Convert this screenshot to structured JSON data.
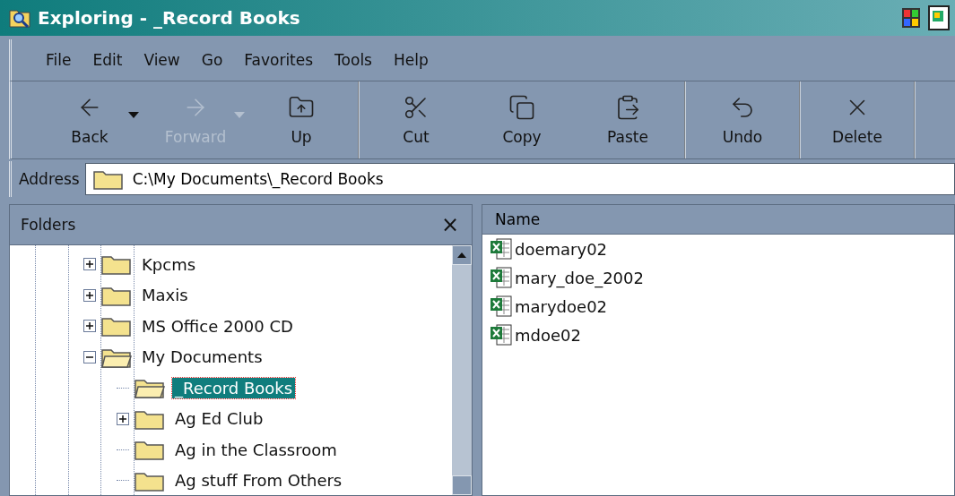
{
  "window": {
    "title": "Exploring - _Record Books"
  },
  "menu": [
    "File",
    "Edit",
    "View",
    "Go",
    "Favorites",
    "Tools",
    "Help"
  ],
  "toolbar": {
    "groups": [
      [
        {
          "label": "Back",
          "kind": "back",
          "disabled": false,
          "dropdown": true
        },
        {
          "label": "Forward",
          "kind": "forward",
          "disabled": true,
          "dropdown": true
        },
        {
          "label": "Up",
          "kind": "up",
          "disabled": false,
          "dropdown": false
        }
      ],
      [
        {
          "label": "Cut",
          "kind": "cut",
          "disabled": false,
          "dropdown": false
        },
        {
          "label": "Copy",
          "kind": "copy",
          "disabled": false,
          "dropdown": false
        },
        {
          "label": "Paste",
          "kind": "paste",
          "disabled": false,
          "dropdown": false
        }
      ],
      [
        {
          "label": "Undo",
          "kind": "undo",
          "disabled": false,
          "dropdown": false
        }
      ],
      [
        {
          "label": "Delete",
          "kind": "delete",
          "disabled": false,
          "dropdown": false
        }
      ]
    ]
  },
  "address": {
    "label": "Address",
    "value": "C:\\My Documents\\_Record Books"
  },
  "folders": {
    "title": "Folders",
    "close": "×",
    "items": [
      {
        "label": "Kpcms",
        "expandable": true,
        "expanded": false,
        "selected": false
      },
      {
        "label": "Maxis",
        "expandable": true,
        "expanded": false,
        "selected": false
      },
      {
        "label": "MS Office 2000 CD",
        "expandable": true,
        "expanded": false,
        "selected": false
      },
      {
        "label": "My Documents",
        "expandable": true,
        "expanded": true,
        "selected": false,
        "children": [
          {
            "label": "_Record Books",
            "expandable": false,
            "expanded": false,
            "selected": true
          },
          {
            "label": "Ag Ed Club",
            "expandable": true,
            "expanded": false,
            "selected": false
          },
          {
            "label": "Ag in the Classroom",
            "expandable": false,
            "expanded": false,
            "selected": false
          },
          {
            "label": "Ag stuff From Others",
            "expandable": false,
            "expanded": false,
            "selected": false
          }
        ]
      }
    ]
  },
  "files": {
    "columns": [
      "Name"
    ],
    "rows": [
      "doemary02",
      "mary_doe_2002",
      "marydoe02",
      "mdoe02"
    ]
  }
}
